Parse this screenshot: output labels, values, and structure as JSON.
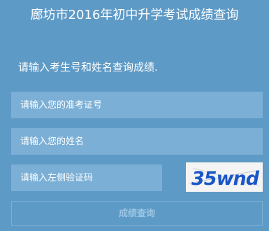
{
  "page": {
    "title": "廊坊市2016年初中升学考试成绩查询",
    "hint": "请输入考生号和姓名查询成绩."
  },
  "form": {
    "exam_number_placeholder": "请输入您的准考证号",
    "name_placeholder": "请输入您的姓名",
    "captcha_placeholder": "请输入左侧验证码",
    "captcha_text": "35wnd",
    "submit_label": "成绩查询"
  },
  "colors": {
    "background": "#5e9ac6",
    "field": "#7bafd6",
    "captcha_digits": "#1a56c8",
    "captcha_letters": "#0e2a8a"
  }
}
